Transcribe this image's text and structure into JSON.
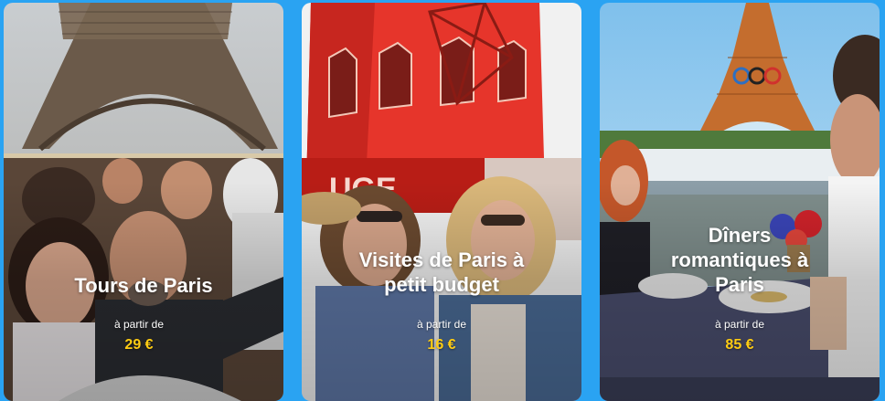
{
  "cards": [
    {
      "title": "Tours de Paris",
      "from_label": "à partir de",
      "price": "29 €",
      "image": "paris-bus-tour-selfie"
    },
    {
      "title": "Visites de Paris à petit budget",
      "from_label": "à partir de",
      "price": "16 €",
      "image": "moulin-rouge-friends"
    },
    {
      "title": "Dîners romantiques à Paris",
      "from_label": "à partir de",
      "price": "85 €",
      "image": "eiffel-tower-seine-dinner-cruise"
    }
  ],
  "colors": {
    "background": "#2aa3f2",
    "price": "#ffcc12",
    "title": "#ffffff"
  }
}
